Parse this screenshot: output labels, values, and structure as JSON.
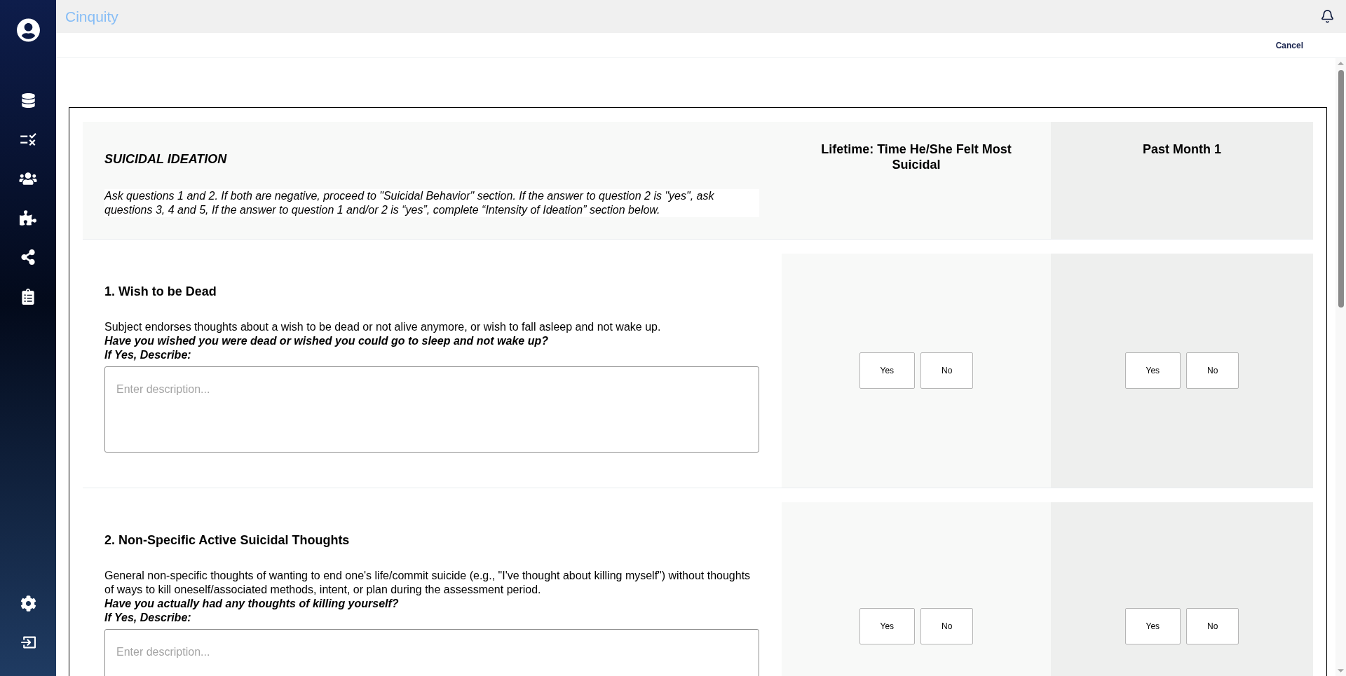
{
  "topbar": {
    "logo": "Cinquity"
  },
  "actions": {
    "cancel": "Cancel"
  },
  "form": {
    "section_title": "SUICIDAL IDEATION",
    "instructions": "Ask questions 1 and 2. If both are negative, proceed to \"Suicidal Behavior\" section. If the answer to question 2 is \"yes\", ask questions 3, 4 and 5, If the answer to question 1 and/or 2 is “yes”, complete “Intensity of Ideation” section below.",
    "columns": [
      "Lifetime: Time He/She Felt Most Suicidal",
      "Past Month 1"
    ],
    "questions": [
      {
        "title": "1. Wish to be Dead",
        "description": "Subject endorses thoughts about a wish to be dead or not alive anymore, or wish to fall asleep and not wake up.",
        "prompt": "Have you wished you were dead or wished you could go to sleep and not wake up?",
        "describe_label": "If Yes, Describe:",
        "placeholder": "Enter description...",
        "answers": [
          {
            "options": [
              {
                "label": "Yes",
                "selected": false
              },
              {
                "label": "No",
                "selected": false
              }
            ]
          },
          {
            "options": [
              {
                "label": "Yes",
                "selected": false
              },
              {
                "label": "No",
                "selected": false
              }
            ]
          }
        ]
      },
      {
        "title": "2. Non-Specific Active Suicidal Thoughts",
        "description": "General non-specific thoughts of wanting to end one's life/commit suicide (e.g., \"I've thought about killing myself\") without thoughts of ways to kill oneself/associated methods, intent, or plan during the assessment period.",
        "prompt": "Have you actually had any thoughts of killing yourself?",
        "describe_label": "If Yes, Describe:",
        "placeholder": "Enter description...",
        "answers": [
          {
            "options": [
              {
                "label": "Yes",
                "selected": false
              },
              {
                "label": "No",
                "selected": false
              }
            ]
          },
          {
            "options": [
              {
                "label": "Yes",
                "selected": false
              },
              {
                "label": "No",
                "selected": false
              }
            ]
          }
        ]
      }
    ]
  }
}
